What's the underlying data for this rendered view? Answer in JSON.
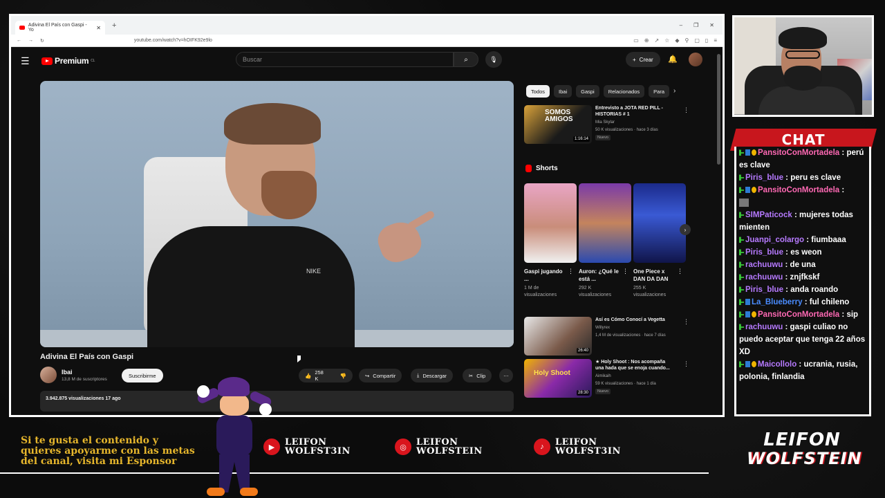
{
  "browser": {
    "tab_title": "Adivina El País con Gaspi - Yo",
    "url": "youtube.com/watch?v=hOIFK92e9lo"
  },
  "youtube": {
    "logo": "Premium",
    "logo_sup": "CL",
    "search_placeholder": "Buscar",
    "create_label": "Crear",
    "video": {
      "title": "Adivina El País con Gaspi",
      "channel": "Ibai",
      "subscribers": "13,8 M de suscriptores",
      "subscribe_label": "Suscribirme",
      "likes": "258 K",
      "share_label": "Compartir",
      "download_label": "Descargar",
      "clip_label": "Clip",
      "views_date": "3.942.875 visualizaciones  17 ago",
      "shirt_logo": "NIKE"
    },
    "chips": [
      "Todos",
      "Ibai",
      "Gaspi",
      "Relacionados",
      "Para"
    ],
    "recommendations": [
      {
        "title": "Entrevisto a JOTA RED PILL - HISTORIAS # 1",
        "channel": "Mia Skylar",
        "meta": "50 K visualizaciones · hace 3 días",
        "badge": "Nuevo",
        "duration": "1:16:14",
        "thumb_text": "SOMOS AMIGOS"
      },
      {
        "title": "Así es Cómo Conocí a Vegetta",
        "channel": "Willyrex",
        "meta": "1,4 M de visualizaciones · hace 7 días",
        "badge": "",
        "duration": "26:40",
        "thumb_text": ""
      },
      {
        "title": "★ Holy Shoot : Nos acompaña una hada que se enoja cuando...",
        "channel": "Aimikaih",
        "meta": "59 K visualizaciones · hace 1 día",
        "badge": "Nuevo",
        "duration": "28:30",
        "thumb_text": "Holy Shoot"
      }
    ],
    "shorts_title": "Shorts",
    "shorts": [
      {
        "title": "Gaspi jugando ...",
        "views": "1 M de visualizaciones"
      },
      {
        "title": "Auron: ¿Qué le está ...",
        "views": "292 K visualizaciones"
      },
      {
        "title": "One Piece x DAN DA DAN",
        "views": "255 K visualizaciones"
      }
    ]
  },
  "chat": {
    "header": "CHAT",
    "messages": [
      {
        "user": "PansitoConMortadela",
        "color": "#ff69b4",
        "text": "perú es clave",
        "badges": [
          "green",
          "blue",
          "yellow"
        ]
      },
      {
        "user": "Piris_blue",
        "color": "#b67aff",
        "text": "peru es clave",
        "badges": [
          "green"
        ]
      },
      {
        "user": "PansitoConMortadela",
        "color": "#ff69b4",
        "text": "",
        "badges": [
          "green",
          "blue",
          "yellow"
        ]
      },
      {
        "user": "SIMPaticock",
        "color": "#b67aff",
        "text": "mujeres todas mienten",
        "badges": [
          "green"
        ]
      },
      {
        "user": "Juanpi_colargo",
        "color": "#b67aff",
        "text": "fiumbaaa",
        "badges": [
          "green"
        ]
      },
      {
        "user": "Piris_blue",
        "color": "#b67aff",
        "text": "es weon",
        "badges": [
          "green"
        ]
      },
      {
        "user": "rachuuwu",
        "color": "#b67aff",
        "text": "de una",
        "badges": [
          "green"
        ]
      },
      {
        "user": "rachuuwu",
        "color": "#b67aff",
        "text": "znjfkskf",
        "badges": [
          "green"
        ]
      },
      {
        "user": "Piris_blue",
        "color": "#b67aff",
        "text": "anda roando",
        "badges": [
          "green"
        ]
      },
      {
        "user": "La_Blueberry",
        "color": "#4a8cff",
        "text": "ful chileno",
        "badges": [
          "green",
          "blue"
        ]
      },
      {
        "user": "PansitoConMortadela",
        "color": "#ff69b4",
        "text": "sip",
        "badges": [
          "green",
          "blue",
          "yellow"
        ]
      },
      {
        "user": "rachuuwu",
        "color": "#b67aff",
        "text": "gaspi culiao no puedo aceptar que tenga 22 años XD",
        "badges": [
          "green"
        ]
      },
      {
        "user": "Maicollolo",
        "color": "#b67aff",
        "text": "ucrania, rusia, polonia, finlandia",
        "badges": [
          "green",
          "blue",
          "yellow"
        ]
      }
    ]
  },
  "overlay": {
    "promo_text": "Si te gusta el contenido y quieres apoyarme con las metas del canal, visita mi Esponsor",
    "socials": [
      {
        "platform": "youtube",
        "line1": "LEIFON",
        "line2": "WOLFST3IN"
      },
      {
        "platform": "instagram",
        "line1": "LEIFON",
        "line2": "WOLFSTEIN"
      },
      {
        "platform": "tiktok",
        "line1": "LEIFON",
        "line2": "WOLFST3IN"
      }
    ],
    "brand_line1": "LEIFON",
    "brand_line2": "WOLFSTEIN",
    "accent_color": "#c8161d",
    "promo_color": "#e6b62c"
  }
}
